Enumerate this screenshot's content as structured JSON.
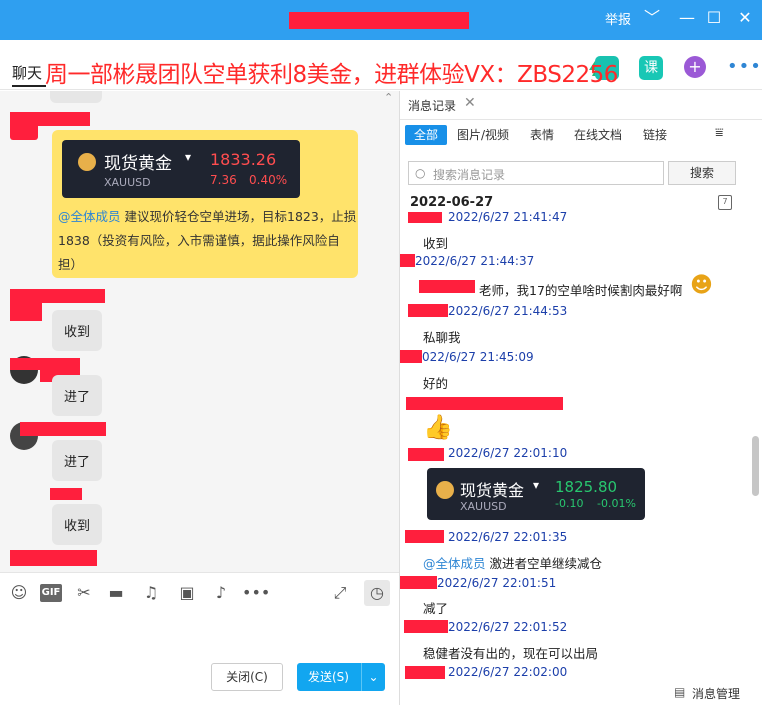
{
  "window": {
    "report_label": "举报",
    "controls": [
      "﹀",
      "—",
      "☐",
      "✕"
    ]
  },
  "header": {
    "chat_tab": "聊天",
    "promo_text": "周一部彬晟团队空单获利8美金，进群体验VX：ZBS2256",
    "ke_label": "课"
  },
  "chat": {
    "gold_card": {
      "title": "现货黄金",
      "symbol": "XAUUSD",
      "price": "1833.26",
      "change": "7.36",
      "change_pct": "0.40%"
    },
    "announcement": {
      "mention": "@全体成员",
      "text": " 建议现价轻仓空单进场，目标1823，止损1838（投资有风险，入市需谨慎，据此操作风险自担）"
    },
    "bubbles": [
      "收到",
      "进了",
      "进了",
      "收到"
    ]
  },
  "toolbar": {
    "icons": [
      "emoji-icon",
      "gif-icon",
      "scissors-icon",
      "folder-icon",
      "music-icon",
      "image-icon",
      "bell-icon",
      "more-icon"
    ],
    "gif_label": "GIF"
  },
  "input": {
    "close_label": "关闭(C)",
    "send_label": "发送(S)"
  },
  "history": {
    "tab_label": "消息记录",
    "filters": [
      "全部",
      "图片/视频",
      "表情",
      "在线文档",
      "链接"
    ],
    "search_placeholder": "搜索消息记录",
    "search_button": "搜索",
    "date_header": "2022-06-27",
    "timestamps": [
      "2022/6/27 21:41:47",
      "2022/6/27 21:44:37",
      "2022/6/27 21:44:53",
      "022/6/27 21:45:09",
      "2022/6/27 22:01:10",
      "2022/6/27 22:01:35",
      "2022/6/27 22:01:51",
      "2022/6/27 22:01:52",
      "2022/6/27 22:02:00"
    ],
    "messages": {
      "m1": "收到",
      "m2": "老师，我17的空单啥时候割肉最好啊",
      "m3": "私聊我",
      "m4": "好的",
      "m6_mention": "@全体成员",
      "m6_text": " 激进者空单继续减仓",
      "m7": "减了",
      "m8": "稳健者没有出的，现在可以出局"
    },
    "gold_card": {
      "title": "现货黄金",
      "symbol": "XAUUSD",
      "price": "1825.80",
      "change": "-0.10",
      "change_pct": "-0.01%"
    },
    "manage_label": "消息管理"
  },
  "colors": {
    "titlebar": "#2f9ff0",
    "redaction": "#ff1f3d",
    "up_price": "#ff4d4f",
    "down_price": "#28c76f",
    "accent": "#1890e8"
  }
}
